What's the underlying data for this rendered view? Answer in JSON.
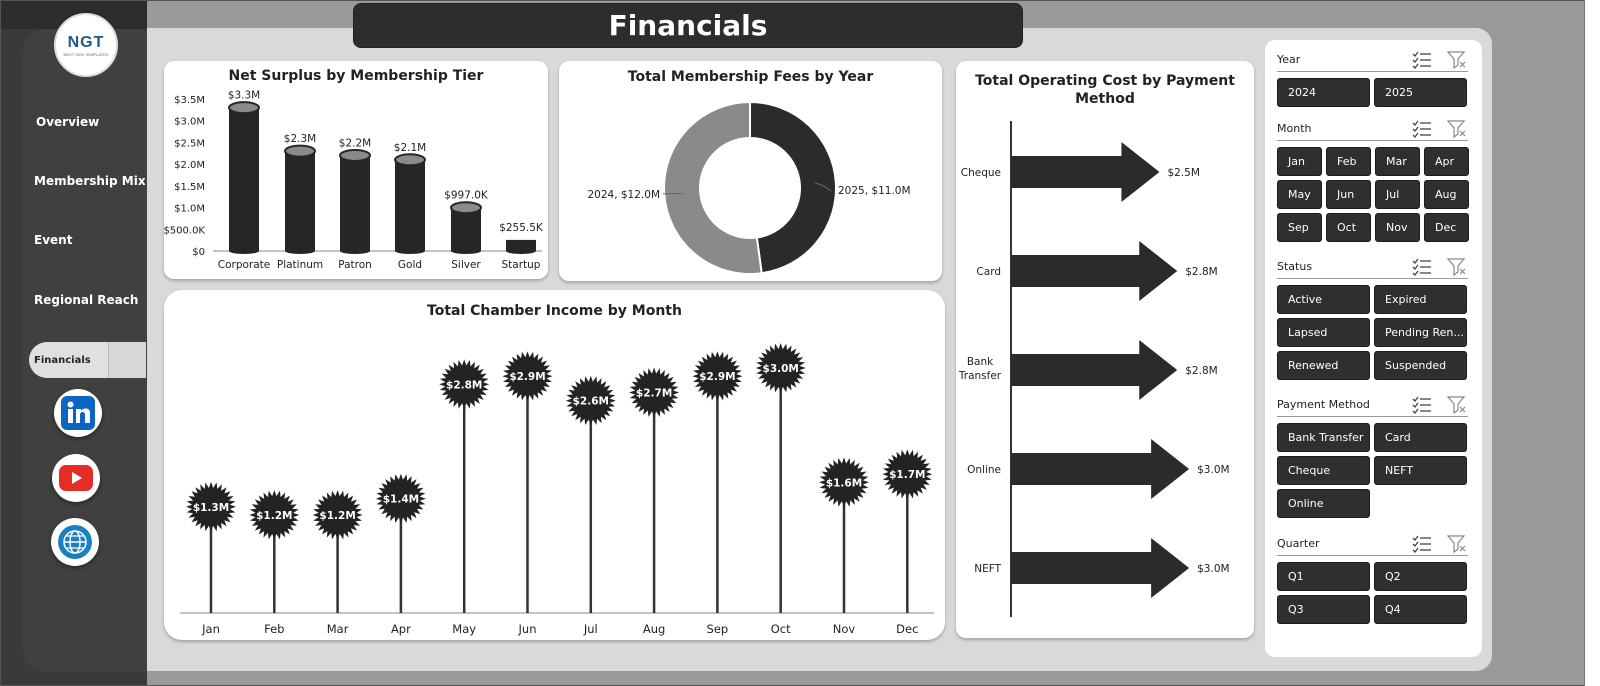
{
  "page": {
    "title": "Financials"
  },
  "logo": {
    "text": "NGT",
    "sub": "NEXT GEN TEMPLATES"
  },
  "nav": {
    "overview": "Overview",
    "membership_mix": "Membership Mix",
    "event": "Event",
    "regional_reach": "Regional Reach",
    "financials": "Financials"
  },
  "colors": {
    "accent_dark": "#2d2d2d",
    "linkedin": "#0a66c2",
    "youtube": "#e52d27",
    "globe": "#1c7fc4"
  },
  "icons": {
    "linkedin": "linkedin-icon",
    "youtube": "youtube-icon",
    "web": "globe-icon",
    "multi_select": "multi-select-icon",
    "clear_filter": "clear-filter-icon"
  },
  "charts": {
    "net_surplus": {
      "title": "Net Surplus by Membership Tier"
    },
    "fees": {
      "title": "Total Membership Fees by Year"
    },
    "operating": {
      "title_line1": "Total Operating Cost by Payment",
      "title_line2": "Method"
    },
    "income": {
      "title": "Total Chamber Income by Month"
    }
  },
  "chart_data": [
    {
      "type": "bar",
      "title": "Net Surplus by Membership Tier",
      "categories": [
        "Corporate",
        "Platinum",
        "Patron",
        "Gold",
        "Silver",
        "Startup"
      ],
      "values": [
        3.3,
        2.3,
        2.2,
        2.1,
        0.997,
        0.2555
      ],
      "data_labels": [
        "$3.3M",
        "$2.3M",
        "$2.2M",
        "$2.1M",
        "$997.0K",
        "$255.5K"
      ],
      "y_ticks": [
        "$0",
        "$500.0K",
        "$1.0M",
        "$1.5M",
        "$2.0M",
        "$2.5M",
        "$3.0M",
        "$3.5M"
      ],
      "ylim": [
        0,
        3.5
      ],
      "unit": "millions"
    },
    {
      "type": "pie",
      "title": "Total Membership Fees by Year",
      "categories": [
        "2025",
        "2024"
      ],
      "values": [
        11.0,
        12.0
      ],
      "data_labels": [
        "2025, $11.0M",
        "2024, $12.0M"
      ],
      "colors": [
        "#2b2b2b",
        "#8a8a8a"
      ]
    },
    {
      "type": "bar",
      "title": "Total Operating Cost by Payment Method",
      "categories": [
        "Cheque",
        "Card",
        "Bank Transfer",
        "Online",
        "NEFT"
      ],
      "values": [
        2.5,
        2.8,
        2.8,
        3.0,
        3.0
      ],
      "data_labels": [
        "$2.5M",
        "$2.8M",
        "$2.8M",
        "$3.0M",
        "$3.0M"
      ]
    },
    {
      "type": "line",
      "title": "Total Chamber Income by Month",
      "categories": [
        "Jan",
        "Feb",
        "Mar",
        "Apr",
        "May",
        "Jun",
        "Jul",
        "Aug",
        "Sep",
        "Oct",
        "Nov",
        "Dec"
      ],
      "values": [
        1.3,
        1.2,
        1.2,
        1.4,
        2.8,
        2.9,
        2.6,
        2.7,
        2.9,
        3.0,
        1.6,
        1.7
      ],
      "data_labels": [
        "$1.3M",
        "$1.2M",
        "$1.2M",
        "$1.4M",
        "$2.8M",
        "$2.9M",
        "$2.6M",
        "$2.7M",
        "$2.9M",
        "$3.0M",
        "$1.6M",
        "$1.7M"
      ]
    }
  ],
  "slicers": {
    "year": {
      "title": "Year",
      "items": [
        "2024",
        "2025"
      ]
    },
    "month": {
      "title": "Month",
      "items": [
        "Jan",
        "Feb",
        "Mar",
        "Apr",
        "May",
        "Jun",
        "Jul",
        "Aug",
        "Sep",
        "Oct",
        "Nov",
        "Dec"
      ]
    },
    "status": {
      "title": "Status",
      "items": [
        "Active",
        "Expired",
        "Lapsed",
        "Pending Ren...",
        "Renewed",
        "Suspended"
      ]
    },
    "payment": {
      "title": "Payment Method",
      "items": [
        "Bank Transfer",
        "Card",
        "Cheque",
        "NEFT",
        "Online"
      ]
    },
    "quarter": {
      "title": "Quarter",
      "items": [
        "Q1",
        "Q2",
        "Q3",
        "Q4"
      ]
    }
  }
}
